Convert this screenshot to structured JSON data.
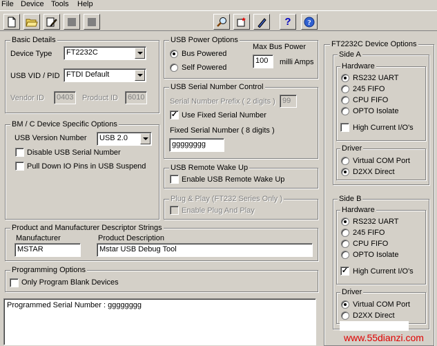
{
  "menu": {
    "file": "File",
    "device": "Device",
    "tools": "Tools",
    "help": "Help"
  },
  "toolbar": {
    "icons": [
      "new-file-icon",
      "open-folder-icon",
      "edit-icon",
      "disabled-icon",
      "disabled-icon",
      "search-icon",
      "program-icon",
      "erase-icon",
      "help-icon",
      "about-icon"
    ]
  },
  "basic": {
    "title": "Basic Details",
    "device_type_label": "Device Type",
    "device_type_value": "FT2232C",
    "vid_pid_label": "USB VID / PID",
    "vid_pid_value": "FTDI Default",
    "vendor_id_label": "Vendor ID",
    "vendor_id_value": "0403",
    "product_id_label": "Product ID",
    "product_id_value": "6010"
  },
  "bmc": {
    "title": "BM / C Device Specific Options",
    "usb_version_label": "USB Version Number",
    "usb_version_value": "USB 2.0",
    "disable_serial": "Disable USB Serial Number",
    "pull_down": "Pull Down IO Pins in USB Suspend"
  },
  "power": {
    "title": "USB Power Options",
    "bus_powered": "Bus Powered",
    "self_powered": "Self Powered",
    "max_label": "Max Bus Power",
    "max_value": "100",
    "unit": "milli Amps"
  },
  "serial": {
    "title": "USB Serial Number Control",
    "prefix_label": "Serial Number Prefix ( 2 digits )",
    "prefix_value": "99",
    "use_fixed": "Use Fixed Serial Number",
    "fixed_label": "Fixed Serial Number ( 8 digits )",
    "fixed_value": "gggggggg"
  },
  "wake": {
    "title": "USB Remote Wake Up",
    "enable": "Enable USB Remote Wake Up"
  },
  "pnp": {
    "title": "Plug & Play  (FT232 Series Only )",
    "enable": "Enable Plug And Play"
  },
  "strings": {
    "title": "Product and Manufacturer Descriptor Strings",
    "manufacturer_label": "Manufacturer",
    "manufacturer_value": "MSTAR",
    "product_label": "Product Description",
    "product_value": "Mstar USB Debug Tool"
  },
  "programming": {
    "title": "Programming Options",
    "only_blank": "Only Program Blank Devices"
  },
  "log": {
    "text": "Programmed Serial Number : gggggggg"
  },
  "ft": {
    "title": "FT2232C Device Options",
    "side_a": {
      "title": "Side A",
      "hw_title": "Hardware",
      "rs232": "RS232 UART",
      "fifo": "245 FIFO",
      "cpu": "CPU FIFO",
      "opto": "OPTO Isolate",
      "high_current": "High Current I/O's",
      "drv_title": "Driver",
      "vcp": "Virtual COM Port",
      "d2xx": "D2XX Direct"
    },
    "side_b": {
      "title": "Side B",
      "hw_title": "Hardware",
      "rs232": "RS232 UART",
      "fifo": "245 FIFO",
      "cpu": "CPU FIFO",
      "opto": "OPTO Isolate",
      "high_current": "High Current I/O's",
      "drv_title": "Driver",
      "vcp": "Virtual COM Port",
      "d2xx": "D2XX Direct"
    }
  },
  "watermark": "www.55dianzi.com"
}
